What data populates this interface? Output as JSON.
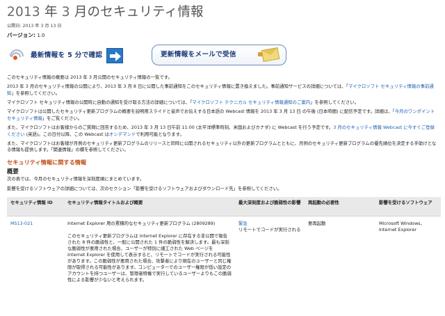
{
  "header": {
    "title_a": "2013",
    "title_b": " 年 ",
    "title_c": "3",
    "title_d": " 月のセキュリティ情報",
    "pubdate": "公開日: 2013 年 3 月 13 日",
    "version_label": "バージョン: ",
    "version_value": "1.0"
  },
  "banners": {
    "rss_label": "最新情報を 5 分で確認",
    "mail_label": "更新情報をメールで受信"
  },
  "intro": {
    "p1": "このセキュリティ情報の概要は 2013 年 3 月公開のセキュリティ情報の一覧です。",
    "p2_text": "2013 年 3 月のセキュリティ情報の公開により、2013 年 3 月 8 日に公開した事前通知をこのセキュリティ情報に置き換えました。事前通知サービスの詳細については、「",
    "p2_link": "マイクロソフト セキュリティ情報の事前通知",
    "p2_tail": "」を参照してください。",
    "p3_text": "マイクロソフト セキュリティ情報の公開時に自動の通知を受け取る方法の詳細については、「",
    "p3_link": "マイクロソフト テクニカル セキュリティ情報通知のご案内",
    "p3_tail": "」を参照してください。",
    "p4_text": "マイクロソフトは公開したセキュリティ更新プログラムの概要を説明用スライドと音声でお伝えする日本語の Webcast 情報を 2013 年 3 月 13 日 の午後 (日本時間) に配信予定です。詳細は、「",
    "p4_link": "今月のワンポイント セキュリティ情報",
    "p4_tail": "」をご覧ください。",
    "p5_text": "また、マイクロソフトはお客様からのご質問に回答するため、2013 年 3 月 13 日午前 11:00 (太平洋標準時刻、米国およびカナダ) に Webcast を行う予定です。",
    "p5_link": "3 月のセキュリティ情報 Webcast に今すぐご登録ください",
    "p5_mid": " (英語)。この日付以降、この Webcast は",
    "p5_link2": "オンデマンド",
    "p5_tail": "で利用可能となります。",
    "p6": "また、マイクロソフトはお客様が月例のセキュリティ更新プログラムのリリースと同時に公開されるセキュリティ以外の更新プログラムとともに、月例のセキュリティ更新プログラムの優先順位を決定する手助けとなる情報も提供します。「関連情報」の欄を参照してください。"
  },
  "section": {
    "heading": "セキュリティ情報に関する情報",
    "subheading": "概要",
    "p1": "次の表では、今月のセキュリティ情報を深刻度順にまとめています。",
    "p2": "影響を受けるソフトウェアの詳細については、次のセクション「影響を受けるソフトウェアおよびダウンロード先」を参照してください。"
  },
  "table": {
    "headers": [
      "セキュリティ情報 ID",
      "セキュリティ情報タイトルおよび概要",
      "最大深刻度および脆弱性の影響",
      "再起動の必要性",
      "影響を受けるソフトウェア"
    ],
    "rows": [
      {
        "id": "MS13-021",
        "title": "Internet Explorer 用の累積的なセキュリティ更新プログラム (2809289)",
        "summary": "このセキュリティ更新プログラムは Internet Explorer に存在する非公開で報告された 8 件の脆弱性と、一般に公開された 1 件の脆弱性を解決します。最も深刻な脆弱性が悪用された場合、ユーザーが特別に細工された Web ページを Internet Explorer を使用して表示すると、リモートでコードが実行される可能性があります。この脆弱性が悪用された場合、攻撃者により現在のユーザーと同じ権限が取得される可能性があります。コンピューターでのユーザー権限が低い設定のアカウントを持つユーザーは、管理者特権で実行しているユーザーよりもこの脆弱性による影響が少ないと考えられます。",
        "severity": "緊急",
        "impact": "リモートでコードが実行される",
        "restart": "要再起動",
        "software": "Microsoft Windows、Internet Explorer"
      }
    ]
  }
}
